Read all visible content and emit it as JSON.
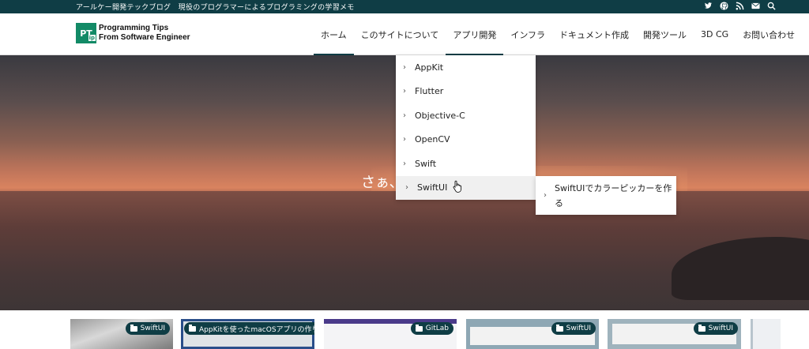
{
  "topbar": {
    "tagline": "アールケー開発テックブログ　現役のプログラマーによるプログラミングの学習メモ",
    "icons": [
      "twitter-icon",
      "github-icon",
      "rss-icon",
      "mail-icon",
      "search-icon"
    ]
  },
  "logo": {
    "mark": "PT",
    "mark_sub": "ip",
    "line1": "Programming Tips",
    "line2": "From Software Engineer"
  },
  "nav": {
    "items": [
      {
        "label": "ホーム"
      },
      {
        "label": "このサイトについて"
      },
      {
        "label": "アプリ開発"
      },
      {
        "label": "インフラ"
      },
      {
        "label": "ドキュメント作成"
      },
      {
        "label": "開発ツール"
      },
      {
        "label": "3D CG"
      },
      {
        "label": "お問い合わせ"
      }
    ]
  },
  "hero": {
    "catchphrase": "さぁ、"
  },
  "dropdown": {
    "items": [
      {
        "label": "AppKit"
      },
      {
        "label": "Flutter"
      },
      {
        "label": "Objective-C"
      },
      {
        "label": "OpenCV"
      },
      {
        "label": "Swift"
      },
      {
        "label": "SwiftUI"
      }
    ],
    "chevron": "›"
  },
  "submenu": {
    "label": "SwiftUIでカラーピッカーを作る"
  },
  "cards": [
    {
      "badge": "SwiftUI"
    },
    {
      "badge": "AppKitを使ったmacOSアプリの作り方"
    },
    {
      "badge": "GitLab"
    },
    {
      "badge": "SwiftUI"
    },
    {
      "badge": "SwiftUI"
    }
  ],
  "colors": {
    "brand": "#0f3d45",
    "logo_green": "#128a66"
  }
}
